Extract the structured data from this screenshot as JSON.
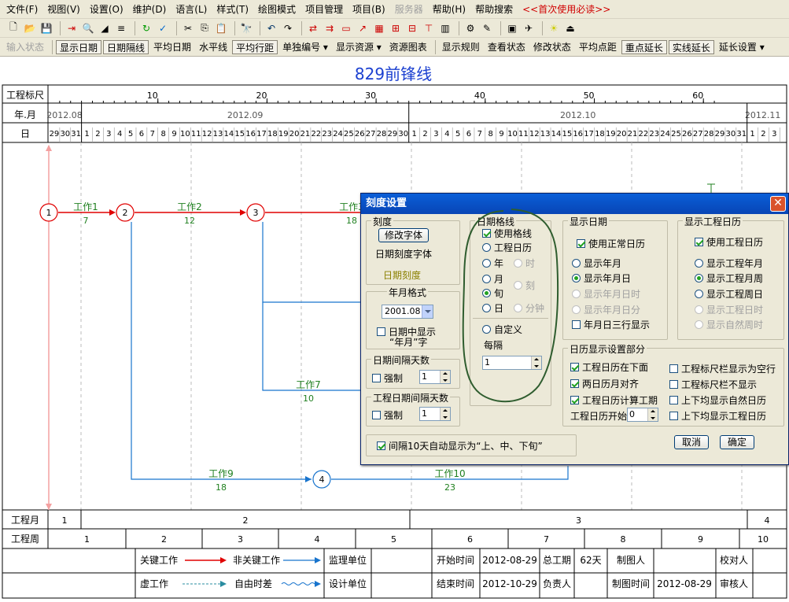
{
  "menu": [
    {
      "label": "文件(F)",
      "state": "normal"
    },
    {
      "label": "视图(V)",
      "state": "normal"
    },
    {
      "label": "设置(O)",
      "state": "normal"
    },
    {
      "label": "维护(D)",
      "state": "normal"
    },
    {
      "label": "语言(L)",
      "state": "normal"
    },
    {
      "label": "样式(T)",
      "state": "normal"
    },
    {
      "label": "绘图模式",
      "state": "normal"
    },
    {
      "label": "项目管理",
      "state": "normal"
    },
    {
      "label": "项目(B)",
      "state": "normal"
    },
    {
      "label": "服务器",
      "state": "disabled"
    },
    {
      "label": "帮助(H)",
      "state": "normal"
    },
    {
      "label": "帮助搜索",
      "state": "normal"
    },
    {
      "label": "<<首次使用必读>>",
      "state": "red"
    }
  ],
  "toolbar_icons": [
    "new-icon",
    "open-icon",
    "save-icon",
    "export-icon",
    "print-preview-icon",
    "triangle-icon",
    "list-icon",
    "refresh-icon",
    "check-icon",
    "cut-icon",
    "copy-icon",
    "paste-icon",
    "find-icon",
    "undo-icon",
    "redo-icon",
    "network-icon",
    "timeline-icon",
    "bar-icon",
    "line-icon",
    "calc-icon",
    "grid-icon",
    "split-icon",
    "tree-icon",
    "books-icon",
    "zoom-icon",
    "settings-icon",
    "monitor-icon",
    "aircraft-icon",
    "bulb-icon",
    "exit-icon"
  ],
  "toolbar2": [
    {
      "label": "输入状态",
      "state": "disabled"
    },
    {
      "label": "显示日期",
      "state": "pressed"
    },
    {
      "label": "日期隔线",
      "state": "pressed"
    },
    {
      "label": "平均日期",
      "state": "normal"
    },
    {
      "label": "水平线",
      "state": "normal"
    },
    {
      "label": "平均行距",
      "state": "pressed"
    },
    {
      "label": "单独编号 ▾",
      "state": "normal"
    },
    {
      "label": "显示资源 ▾",
      "state": "normal"
    },
    {
      "label": "资源图表",
      "state": "normal"
    },
    {
      "label": "显示规则",
      "state": "normal"
    },
    {
      "label": "查看状态",
      "state": "normal"
    },
    {
      "label": "修改状态",
      "state": "normal"
    },
    {
      "label": "平均点距",
      "state": "normal"
    },
    {
      "label": "重点延长",
      "state": "pressed"
    },
    {
      "label": "实线延长",
      "state": "pressed"
    },
    {
      "label": "延长设置 ▾",
      "state": "normal"
    }
  ],
  "chart": {
    "title": "829前锋线",
    "ruler_label": "工程标尺",
    "ym_label": "年.月",
    "day_label": "日",
    "ruler_ticks": [
      "10",
      "20",
      "30",
      "40",
      "50",
      "60"
    ],
    "months": [
      "2012.08",
      "2012.09",
      "2012.10",
      "2012.11"
    ],
    "days_aug": [
      "29",
      "30",
      "31"
    ],
    "days_sep": [
      "1",
      "2",
      "3",
      "4",
      "5",
      "6",
      "7",
      "8",
      "9",
      "10",
      "11",
      "12",
      "13",
      "14",
      "15",
      "16",
      "17",
      "18",
      "19",
      "20",
      "21",
      "22",
      "23",
      "24",
      "25",
      "26",
      "27",
      "28",
      "29",
      "30"
    ],
    "days_oct": [
      "1",
      "2",
      "3",
      "4",
      "5",
      "6",
      "7",
      "8",
      "9",
      "10",
      "11",
      "12",
      "13",
      "14",
      "15",
      "16",
      "17",
      "18",
      "19",
      "20",
      "21",
      "22",
      "23",
      "24",
      "25",
      "26",
      "27",
      "28",
      "29",
      "30",
      "31"
    ],
    "days_nov": [
      "1",
      "2",
      "3"
    ],
    "nodes": [
      "1",
      "2",
      "3",
      "4"
    ],
    "tasks": [
      {
        "name": "工作1",
        "dur": "7"
      },
      {
        "name": "工作2",
        "dur": "12"
      },
      {
        "name": "工作3",
        "dur": "18"
      },
      {
        "name": "工作7",
        "dur": "10"
      },
      {
        "name": "工作9",
        "dur": "18"
      },
      {
        "name": "工作10",
        "dur": "23"
      }
    ],
    "proj_month_label": "工程月",
    "proj_months": [
      "1",
      "2",
      "3",
      "4"
    ],
    "proj_week_label": "工程周",
    "proj_weeks": [
      "1",
      "2",
      "3",
      "4",
      "5",
      "6",
      "7",
      "8",
      "9",
      "10"
    ],
    "legend": {
      "critical": "关键工作",
      "noncritical": "非关键工作",
      "virtual": "虚工作",
      "free_float": "自由时差",
      "supervisor": "监理单位",
      "designer": "设计单位",
      "start_label": "开始时间",
      "start": "2012-08-29",
      "end_label": "结束时间",
      "end": "2012-10-29",
      "total_label": "总工期",
      "total": "62天",
      "manager_label": "负责人",
      "drawer_label": "制图人",
      "draw_time_label": "制图时间",
      "draw_time": "2012-08-29",
      "checker_label": "校对人",
      "reviewer_label": "审核人"
    },
    "colors": {
      "critical": "#e00000",
      "noncritical": "#1874cd",
      "task_label": "#208020",
      "title": "#1a3fd0",
      "free_float": "#1874cd"
    }
  },
  "dialog": {
    "title": "刻度设置",
    "scale_group": "刻度",
    "modify_font": "修改字体",
    "date_scale_font": "日期刻度字体",
    "date_scale_sample": "日期刻度",
    "ym_format_group": "年月格式",
    "ym_format_value": "2001.08",
    "show_ym_char": "日期中显示",
    "show_ym_char2": "“年月”字",
    "date_interval_group": "日期间隔天数",
    "force1": "强制",
    "force1_value": "1",
    "proj_date_interval_group": "工程日期间隔天数",
    "force2": "强制",
    "force2_value": "1",
    "gridline_group": "日期格线",
    "use_gridline": "使用格线",
    "proj_calendar": "工程日历",
    "r_year": "年",
    "r_hour": "时",
    "r_month": "月",
    "r_quarter": "刻",
    "r_xun": "旬",
    "r_day": "日",
    "r_minute": "分钟",
    "custom": "自定义",
    "every_interval": "每隔",
    "interval_value": "1",
    "show_date_group": "显示日期",
    "use_normal_cal": "使用正常日历",
    "show_ym": "显示年月",
    "show_ymd": "显示年月日",
    "show_ymdh": "显示年月日时",
    "show_ymdhm": "显示年月日分",
    "ymd_three_rows": "年月日三行显示",
    "show_proj_cal_group": "显示工程日历",
    "use_proj_cal": "使用工程日历",
    "show_proj_ym": "显示工程年月",
    "show_proj_ymweek": "显示工程月周",
    "show_proj_weekday": "显示工程周日",
    "show_proj_day": "显示工程日时",
    "show_natural_week": "显示自然周时",
    "cal_display_group": "日历显示设置部分",
    "proj_cal_below": "工程日历在下面",
    "two_cal_align": "两日历月对齐",
    "proj_cal_compute": "工程日历计算工期",
    "proj_cal_start": "工程日历开始",
    "proj_cal_start_value": "0",
    "ruler_empty_row": "工程标尺栏显示为空行",
    "ruler_hidden": "工程标尺栏不显示",
    "both_natural": "上下均显示自然日历",
    "both_proj": "上下均显示工程日历",
    "auto_xun": "间隔10天自动显示为“上、中、下旬”",
    "cancel": "取消",
    "ok": "确定"
  }
}
